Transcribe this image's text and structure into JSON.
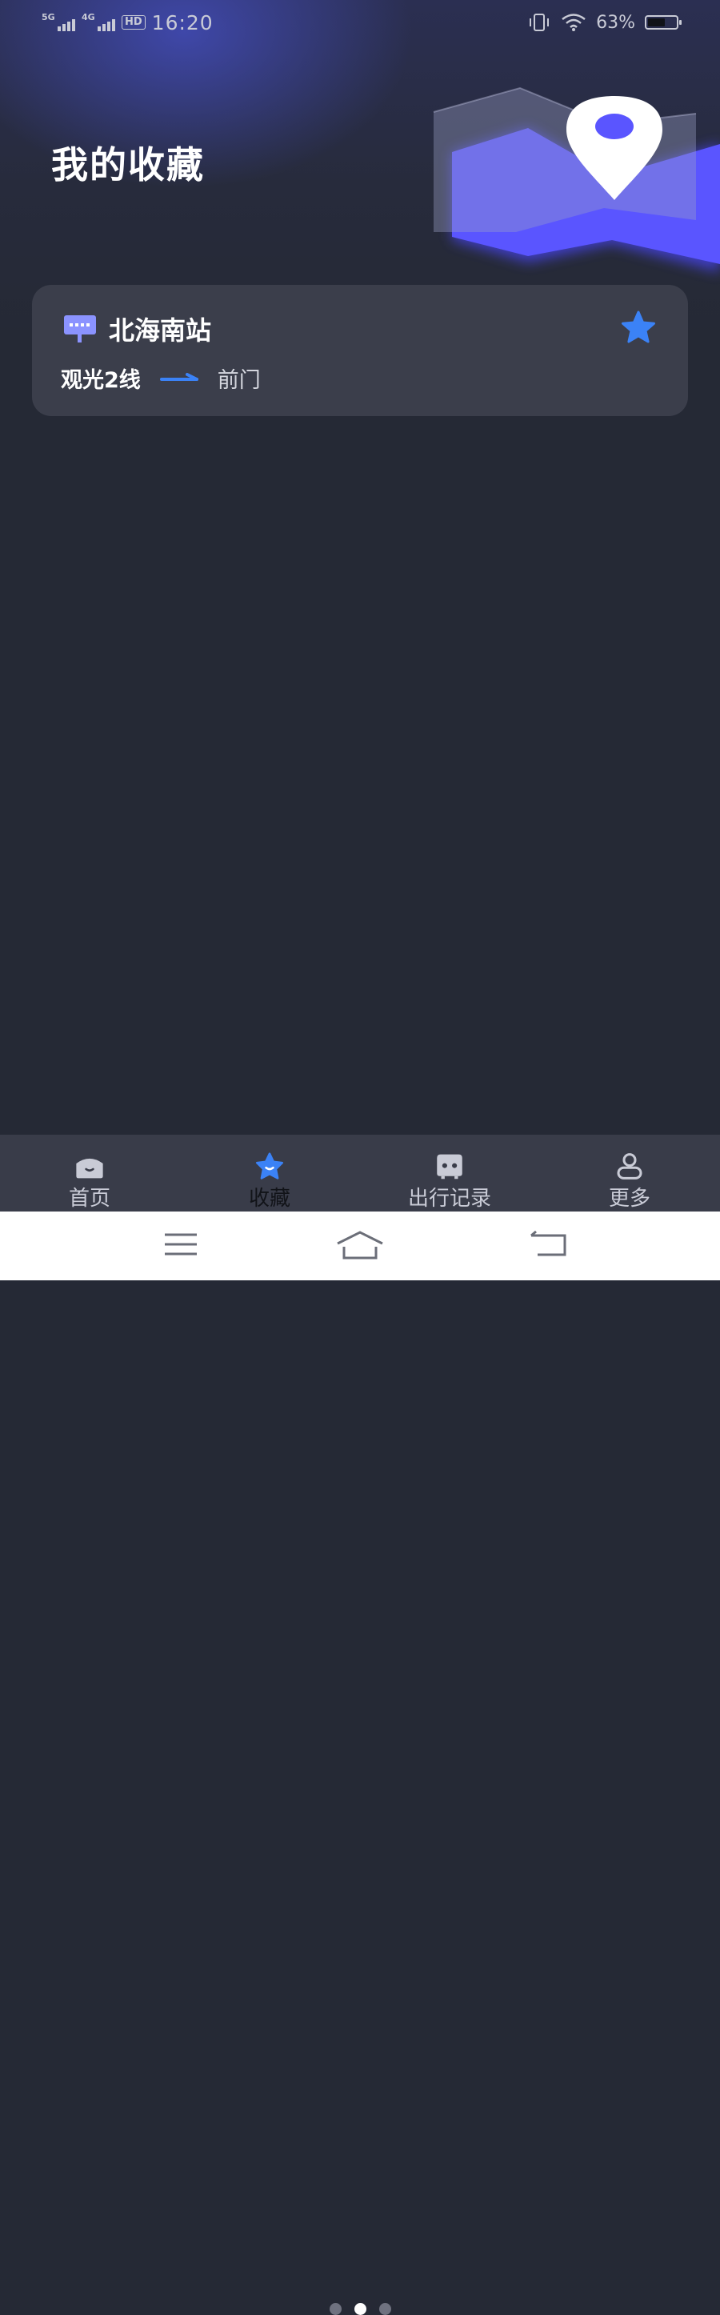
{
  "status_bar": {
    "signal1": "5G",
    "signal2": "4G",
    "hd": "HD",
    "time": "16:20",
    "battery_percent": "63%",
    "battery_level": 0.63
  },
  "page": {
    "title": "我的收藏"
  },
  "favorites": [
    {
      "station": "北海南站",
      "line": "观光2线",
      "direction": "前门",
      "starred": true
    }
  ],
  "tab_bar": {
    "items": [
      {
        "label": "首页",
        "icon": "home-icon",
        "active": false
      },
      {
        "label": "收藏",
        "icon": "star-icon",
        "active": true
      },
      {
        "label": "出行记录",
        "icon": "bus-icon",
        "active": false
      },
      {
        "label": "更多",
        "icon": "person-icon",
        "active": false
      }
    ],
    "pager_dots": 3,
    "pager_active": 1
  },
  "colors": {
    "background": "#252935",
    "card": "#3b3e4b",
    "accent": "#3b82f6",
    "purple": "#5b5cff",
    "tab_bar": "#393c49"
  }
}
